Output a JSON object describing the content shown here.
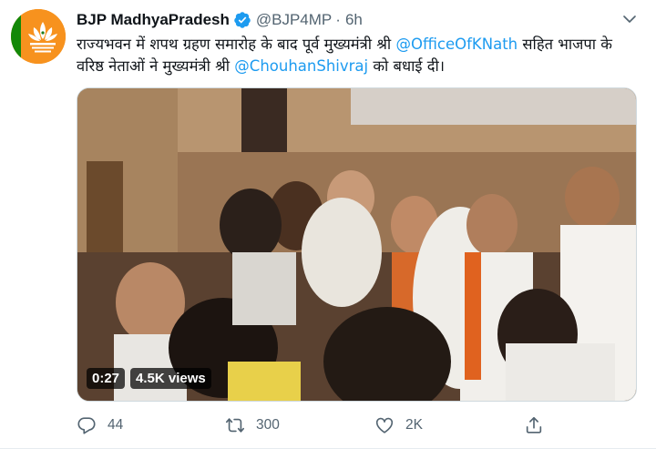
{
  "tweet": {
    "display_name": "BJP MadhyaPradesh",
    "handle": "@BJP4MP",
    "separator": "·",
    "time": "6h",
    "text_segments": [
      {
        "text": "राज्यभवन में शपथ ग्रहण समारोह के बाद पूर्व मुख्यमंत्री श्री ",
        "mention": false
      },
      {
        "text": "@OfficeOfKNath",
        "mention": true
      },
      {
        "text": " सहित भाजपा के वरिष्ठ नेताओं ने मुख्यमंत्री श्री ",
        "mention": false
      },
      {
        "text": "@ChouhanShivraj",
        "mention": true
      },
      {
        "text": " को बधाई दी।",
        "mention": false
      }
    ],
    "icons": {
      "verified": "verified-badge-icon",
      "caret": "chevron-down-icon",
      "reply": "reply-icon",
      "retweet": "retweet-icon",
      "like": "heart-icon",
      "share": "share-icon"
    }
  },
  "video": {
    "duration": "0:27",
    "views": "4.5K views"
  },
  "actions": {
    "reply_count": "44",
    "retweet_count": "300",
    "like_count": "2K"
  },
  "colors": {
    "accent": "#1d9bf0",
    "muted": "#536471",
    "avatar_bg": "#f7921e"
  }
}
